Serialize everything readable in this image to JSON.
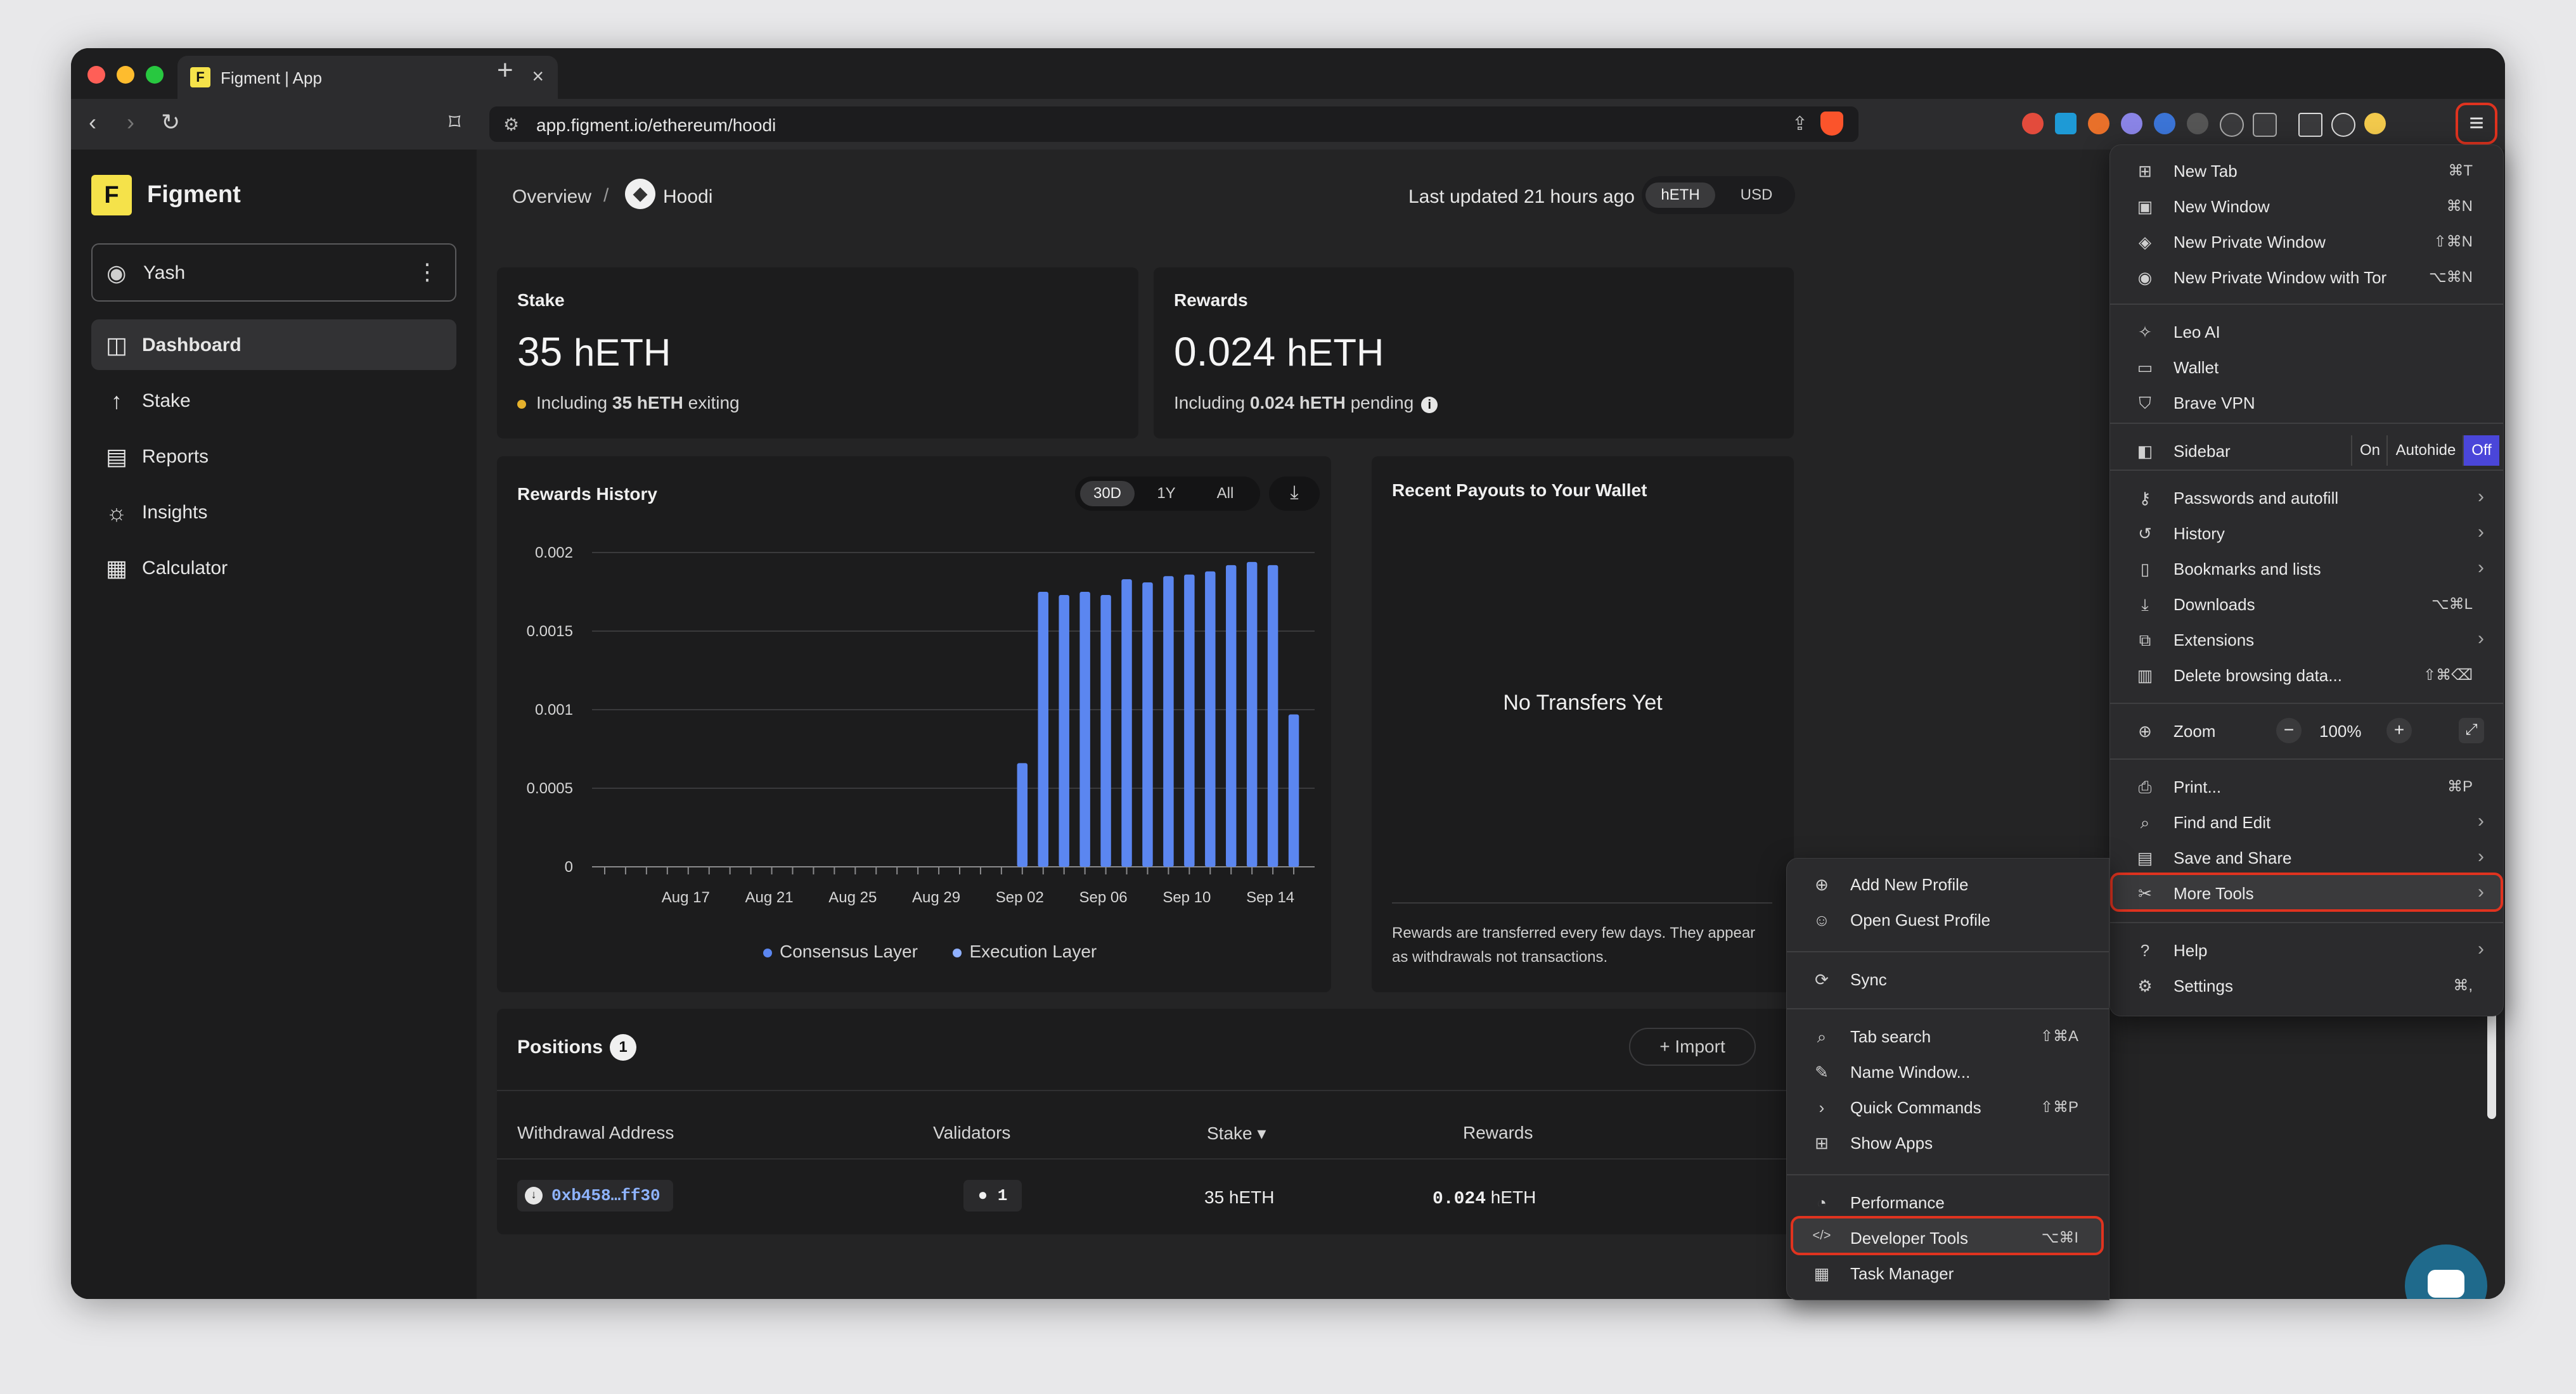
{
  "browser": {
    "tab_title": "Figment | App",
    "tab_favicon": "F",
    "url": "app.figment.io/ethereum/hoodi",
    "new_tab_glyph": "+",
    "close_glyph": "×"
  },
  "sidebar": {
    "logo_letter": "F",
    "brand": "Figment",
    "user": "Yash",
    "items": [
      {
        "label": "Dashboard",
        "icon": "chart-icon"
      },
      {
        "label": "Stake",
        "icon": "arrow-up-icon"
      },
      {
        "label": "Reports",
        "icon": "report-icon"
      },
      {
        "label": "Insights",
        "icon": "bulb-icon"
      },
      {
        "label": "Calculator",
        "icon": "calculator-icon"
      }
    ]
  },
  "header": {
    "breadcrumb_root": "Overview",
    "breadcrumb_sep": "/",
    "breadcrumb_current": "Hoodi",
    "last_updated": "Last updated 21 hours ago",
    "currencies": [
      "hETH",
      "USD"
    ]
  },
  "stake": {
    "label": "Stake",
    "value": "35",
    "unit": "hETH",
    "sub_prefix": "Including ",
    "sub_bold": "35 hETH",
    "sub_suffix": " exiting"
  },
  "rewards": {
    "label": "Rewards",
    "value": "0.024",
    "unit": "hETH",
    "sub_prefix": "Including ",
    "sub_bold": "0.024 hETH",
    "sub_suffix": " pending",
    "info_glyph": "i"
  },
  "rewards_history": {
    "title": "Rewards History",
    "ranges": [
      "30D",
      "1Y",
      "All"
    ],
    "legend": [
      "Consensus Layer",
      "Execution Layer"
    ]
  },
  "chart_data": {
    "type": "bar",
    "title": "Rewards History",
    "y_ticks": [
      "0.002",
      "0.0015",
      "0.001",
      "0.0005",
      "0"
    ],
    "ylim": [
      0,
      0.002
    ],
    "x_labels": [
      "Aug 17",
      "Aug 21",
      "Aug 25",
      "Aug 29",
      "Sep 02",
      "Sep 06",
      "Sep 10",
      "Sep 14"
    ],
    "series": [
      {
        "name": "Consensus Layer",
        "color": "#5b86f0"
      },
      {
        "name": "Execution Layer",
        "color": "#8fb0ff"
      }
    ],
    "bars": [
      {
        "date": "Sep 02",
        "value": 0.00066
      },
      {
        "date": "Sep 03",
        "value": 0.00175
      },
      {
        "date": "Sep 04",
        "value": 0.00173
      },
      {
        "date": "Sep 05",
        "value": 0.00175
      },
      {
        "date": "Sep 06",
        "value": 0.00173
      },
      {
        "date": "Sep 07",
        "value": 0.00183
      },
      {
        "date": "Sep 08",
        "value": 0.00181
      },
      {
        "date": "Sep 09",
        "value": 0.00185
      },
      {
        "date": "Sep 10",
        "value": 0.00186
      },
      {
        "date": "Sep 11",
        "value": 0.00188
      },
      {
        "date": "Sep 12",
        "value": 0.00192
      },
      {
        "date": "Sep 13",
        "value": 0.00194
      },
      {
        "date": "Sep 14",
        "value": 0.00192
      },
      {
        "date": "Sep 15",
        "value": 0.00097
      }
    ]
  },
  "payouts": {
    "title": "Recent Payouts to Your Wallet",
    "empty": "No Transfers Yet",
    "note": "Rewards are transferred every few days. They appear as withdrawals not transactions."
  },
  "positions": {
    "title": "Positions",
    "count": "1",
    "import_label": "+ Import",
    "headers": [
      "Withdrawal Address",
      "Validators",
      "Stake ▾",
      "Rewards"
    ],
    "row": {
      "address": "0xb458…ff30",
      "validators": "● 1",
      "stake": "35 hETH",
      "rewards_num": "0.024",
      "rewards_unit": " hETH"
    }
  },
  "main_menu": {
    "group1": [
      {
        "label": "New Tab",
        "shortcut": "⌘T",
        "icon": "new-tab-icon"
      },
      {
        "label": "New Window",
        "shortcut": "⌘N",
        "icon": "new-window-icon"
      },
      {
        "label": "New Private Window",
        "shortcut": "⇧⌘N",
        "icon": "private-window-icon"
      },
      {
        "label": "New Private Window with Tor",
        "shortcut": "⌥⌘N",
        "icon": "tor-window-icon"
      }
    ],
    "group2": [
      {
        "label": "Leo AI",
        "icon": "leo-icon"
      },
      {
        "label": "Wallet",
        "icon": "wallet-icon"
      },
      {
        "label": "Brave VPN",
        "icon": "vpn-icon"
      }
    ],
    "sidebar_label": "Sidebar",
    "sidebar_options": [
      "On",
      "Autohide",
      "Off"
    ],
    "group3": [
      {
        "label": "Passwords and autofill",
        "shortcut": "",
        "icon": "key-icon",
        "arrow": "›"
      },
      {
        "label": "History",
        "shortcut": "",
        "icon": "history-icon",
        "arrow": "›"
      },
      {
        "label": "Bookmarks and lists",
        "shortcut": "",
        "icon": "bookmarks-icon",
        "arrow": "›"
      },
      {
        "label": "Downloads",
        "shortcut": "⌥⌘L",
        "icon": "download-icon",
        "arrow": ""
      },
      {
        "label": "Extensions",
        "shortcut": "",
        "icon": "extensions-icon",
        "arrow": "›"
      },
      {
        "label": "Delete browsing data...",
        "shortcut": "⇧⌘⌫",
        "icon": "trash-icon",
        "arrow": ""
      }
    ],
    "zoom_label": "Zoom",
    "zoom_value": "100%",
    "zoom_minus": "−",
    "zoom_plus": "+",
    "group4": [
      {
        "label": "Print...",
        "shortcut": "⌘P",
        "icon": "print-icon",
        "arrow": ""
      },
      {
        "label": "Find and Edit",
        "shortcut": "",
        "icon": "find-icon",
        "arrow": "›"
      },
      {
        "label": "Save and Share",
        "shortcut": "",
        "icon": "save-icon",
        "arrow": "›"
      },
      {
        "label": "More Tools",
        "shortcut": "",
        "icon": "tools-icon",
        "arrow": "›"
      }
    ],
    "group5": [
      {
        "label": "Help",
        "shortcut": "",
        "icon": "help-icon",
        "arrow": "›"
      },
      {
        "label": "Settings",
        "shortcut": "⌘,",
        "icon": "settings-icon",
        "arrow": ""
      }
    ]
  },
  "more_tools_menu": {
    "group1": [
      {
        "label": "Add New Profile",
        "shortcut": "",
        "icon": "add-profile-icon"
      },
      {
        "label": "Open Guest Profile",
        "shortcut": "",
        "icon": "guest-profile-icon"
      }
    ],
    "group2": [
      {
        "label": "Sync",
        "shortcut": "",
        "icon": "sync-icon"
      }
    ],
    "group3": [
      {
        "label": "Tab search",
        "shortcut": "⇧⌘A",
        "icon": "tab-search-icon"
      },
      {
        "label": "Name Window...",
        "shortcut": "",
        "icon": "rename-icon"
      },
      {
        "label": "Quick Commands",
        "shortcut": "⇧⌘P",
        "icon": "chevron-icon"
      },
      {
        "label": "Show Apps",
        "shortcut": "",
        "icon": "apps-icon"
      }
    ],
    "group4": [
      {
        "label": "Performance",
        "shortcut": "",
        "icon": "gauge-icon"
      },
      {
        "label": "Developer Tools",
        "shortcut": "⌥⌘I",
        "icon": "code-icon"
      },
      {
        "label": "Task Manager",
        "shortcut": "",
        "icon": "task-manager-icon"
      }
    ]
  }
}
